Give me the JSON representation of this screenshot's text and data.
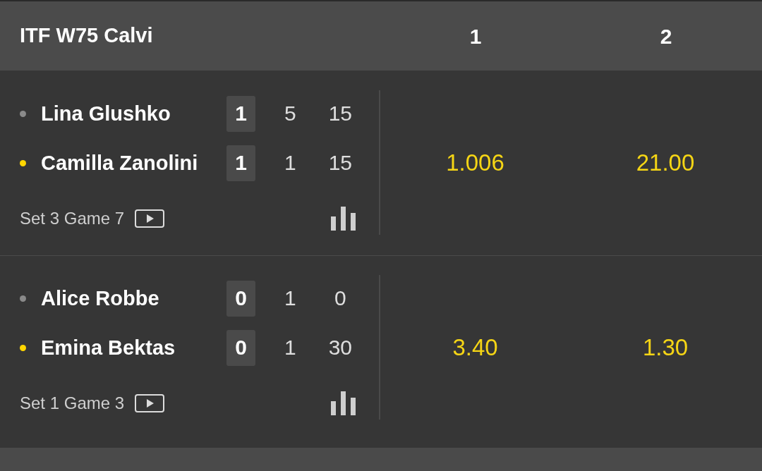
{
  "header": {
    "title": "ITF W75 Calvi",
    "columns": [
      "1",
      "2"
    ]
  },
  "matches": [
    {
      "players": [
        {
          "name": "Lina Glushko",
          "serving": false,
          "sets": "1",
          "games": "5",
          "points": "15"
        },
        {
          "name": "Camilla Zanolini",
          "serving": true,
          "sets": "1",
          "games": "1",
          "points": "15"
        }
      ],
      "status": "Set 3 Game 7",
      "odds": [
        "1.006",
        "21.00"
      ]
    },
    {
      "players": [
        {
          "name": "Alice Robbe",
          "serving": false,
          "sets": "0",
          "games": "1",
          "points": "0"
        },
        {
          "name": "Emina Bektas",
          "serving": true,
          "sets": "0",
          "games": "1",
          "points": "30"
        }
      ],
      "status": "Set 1 Game 3",
      "odds": [
        "3.40",
        "1.30"
      ]
    }
  ]
}
